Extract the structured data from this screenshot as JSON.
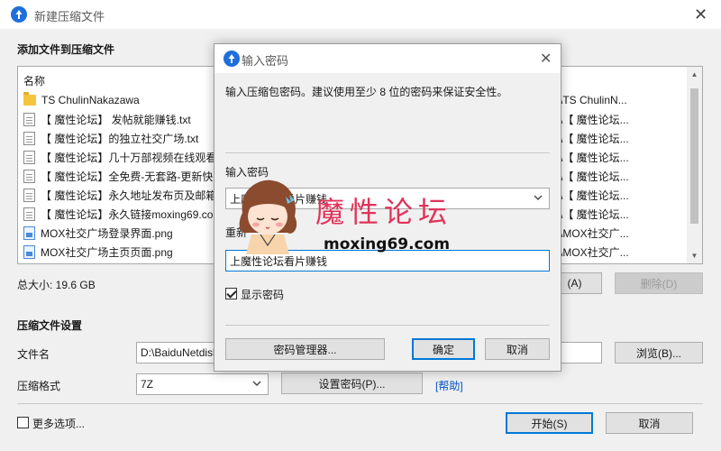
{
  "main": {
    "title": "新建压缩文件",
    "add_section_label": "添加文件到压缩文件",
    "file_list": {
      "column_name": "名称",
      "rows": [
        {
          "icon": "folder-icon",
          "name": "TS ChulinNakazawa",
          "path": "\\TS ChulinN..."
        },
        {
          "icon": "text-file-icon",
          "name": "【 魔性论坛】 发帖就能赚钱.txt",
          "path": "\\【 魔性论坛..."
        },
        {
          "icon": "text-file-icon",
          "name": "【 魔性论坛】的独立社交广场.txt",
          "path": "\\【 魔性论坛..."
        },
        {
          "icon": "text-file-icon",
          "name": "【 魔性论坛】几十万部视频在线观看",
          "path": "\\【 魔性论坛..."
        },
        {
          "icon": "text-file-icon",
          "name": "【 魔性论坛】全免费-无套路-更新快",
          "path": "\\【 魔性论坛..."
        },
        {
          "icon": "text-file-icon",
          "name": "【 魔性论坛】永久地址发布页及邮箱",
          "path": "\\【 魔性论坛..."
        },
        {
          "icon": "text-file-icon",
          "name": "【 魔性论坛】永久链接moxing69.com",
          "path": "\\【 魔性论坛..."
        },
        {
          "icon": "image-file-icon",
          "name": "MOX社交广场登录界面.png",
          "path": "\\MOX社交广..."
        },
        {
          "icon": "image-file-icon",
          "name": "MOX社交广场主页页面.png",
          "path": "\\MOX社交广..."
        }
      ]
    },
    "total_size": "总大小: 19.6 GB",
    "add_button": "(A)",
    "delete_button": "删除(D)",
    "settings_section_label": "压缩文件设置",
    "filename_label": "文件名",
    "filename_value": "D:\\BaiduNetdisk",
    "browse_button": "浏览(B)...",
    "format_label": "压缩格式",
    "format_value": "7Z",
    "set_password_button": "设置密码(P)...",
    "help_link": "[帮助]",
    "more_options_label": "更多选项...",
    "start_button": "开始(S)",
    "cancel_button": "取消"
  },
  "dialog": {
    "title": "输入密码",
    "hint": "输入压缩包密码。建议使用至少 8 位的密码来保证安全性。",
    "password_label": "输入密码",
    "password_value": "上魔性论坛看片赚钱",
    "confirm_label": "重新",
    "confirm_value": "上魔性论坛看片赚钱",
    "show_password_label": "显示密码",
    "show_password_checked": true,
    "password_manager_button": "密码管理器...",
    "ok_button": "确定",
    "cancel_button": "取消"
  },
  "watermark": {
    "text": "魔性论坛",
    "url": "moxing69.com"
  },
  "colors": {
    "accent": "#0078d7",
    "app_icon": "#1e6fd9",
    "watermark": "#e0345a",
    "link": "#0050c8"
  }
}
